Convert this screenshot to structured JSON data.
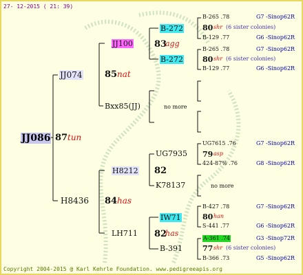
{
  "header": {
    "date": "27- 12-2015 ( 21: 39)",
    "footer": "Copyright 2004-2015 @ Karl Kehrle Foundation.  www.pedigreeapis.org"
  },
  "root": {
    "name": "JJ086",
    "value": "87",
    "race": "tun"
  },
  "mother": {
    "name": "JJ074",
    "value": "85",
    "race": "nat"
  },
  "father": {
    "name": "H8436",
    "value": "84",
    "race": "has"
  },
  "mm": {
    "name": "JJ100",
    "value": "83",
    "race": "agg"
  },
  "mf": {
    "name": "Bxx85(JJ)",
    "note": "no more"
  },
  "fm": {
    "name": "H8212",
    "value": "82"
  },
  "ff": {
    "name": "LH711",
    "value": "82",
    "race": "has"
  },
  "mmm": {
    "name": "B-272",
    "lines": {
      "a": "B-265 .78",
      "a_cat": "G7 -Sinop62R",
      "value": "80",
      "race": "shr",
      "note": "(6 sister colonies)",
      "b": "B-129 .77",
      "b_cat": "G6 -Sinop62R"
    }
  },
  "mmf": {
    "name": "B-272",
    "lines": {
      "a": "B-265 .78",
      "a_cat": "G7 -Sinop62R",
      "value": "80",
      "race": "shr",
      "note": "(6 sister colonies)",
      "b": "B-129 .77",
      "b_cat": "G6 -Sinop62R"
    }
  },
  "fmm": {
    "name": "UG7935",
    "lines": {
      "a": "UG7615 .76",
      "a_cat": "G7 -Sinop62R",
      "value": "79",
      "race": "asp",
      "b": "424-87% .76",
      "b_cat": "G8 -Sinop62R"
    }
  },
  "fmf": {
    "name": "K78137",
    "note": "no more"
  },
  "ffm": {
    "name": "IW71",
    "lines": {
      "a": "B-427 .78",
      "a_cat": "G7 -Sinop62R",
      "value": "80",
      "race": "han",
      "b": "S-441 .77",
      "b_cat": "G6 -Sinop62R"
    }
  },
  "fff": {
    "name": "B-391",
    "lines": {
      "a": "A-361 .74",
      "a_cat": "G3 -Sinop72R",
      "value": "77",
      "race": "shr",
      "note": "(6 sister colonies)",
      "b": "B-366 .73",
      "b_cat": "G5 -Sinop62R"
    }
  }
}
